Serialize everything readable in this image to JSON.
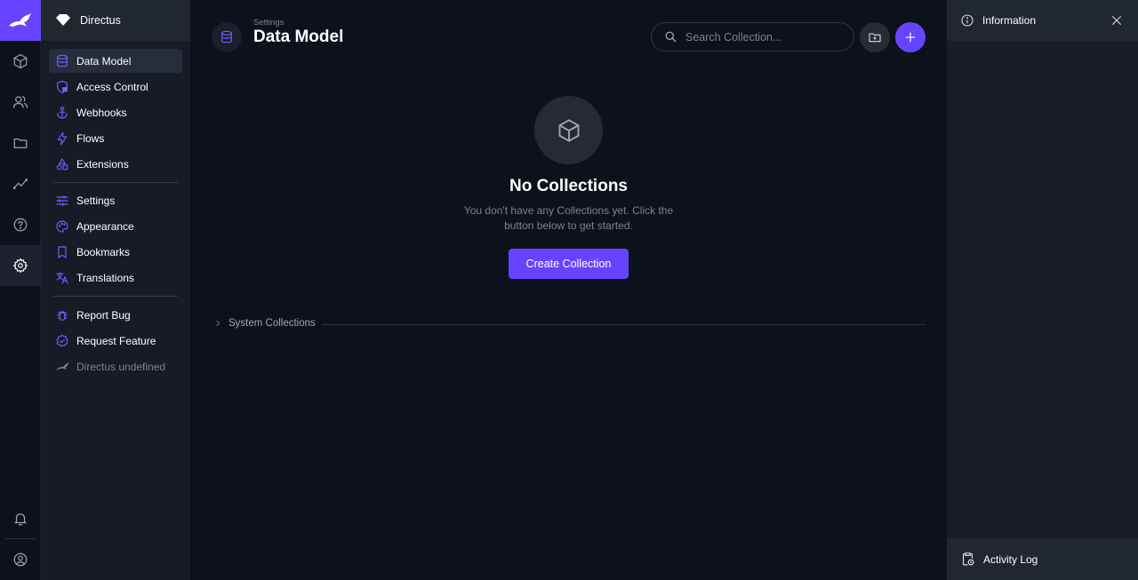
{
  "colors": {
    "accent": "#6644ff",
    "background": "#0c111b",
    "nav": "#161b25"
  },
  "module_bar": {
    "logo": "directus-rabbit-logo",
    "modules": [
      "content-cube-icon",
      "users-icon",
      "files-folder-icon",
      "insights-chart-icon",
      "help-icon",
      "settings-gear-icon"
    ],
    "bottom": [
      "notifications-bell-icon",
      "user-account-icon"
    ]
  },
  "nav": {
    "project_name": "Directus",
    "items": [
      {
        "label": "Data Model",
        "icon": "database-icon"
      },
      {
        "label": "Access Control",
        "icon": "access-control-icon"
      },
      {
        "label": "Webhooks",
        "icon": "anchor-icon"
      },
      {
        "label": "Flows",
        "icon": "bolt-icon"
      },
      {
        "label": "Extensions",
        "icon": "shapes-icon"
      },
      {
        "label": "Settings",
        "icon": "tune-icon"
      },
      {
        "label": "Appearance",
        "icon": "palette-icon"
      },
      {
        "label": "Bookmarks",
        "icon": "bookmark-icon"
      },
      {
        "label": "Translations",
        "icon": "translate-icon"
      },
      {
        "label": "Report Bug",
        "icon": "bug-icon"
      },
      {
        "label": "Request Feature",
        "icon": "verified-icon"
      },
      {
        "label": "Directus undefined",
        "icon": "directus-logo-icon"
      }
    ]
  },
  "header": {
    "breadcrumb": "Settings",
    "title": "Data Model",
    "search_placeholder": "Search Collection..."
  },
  "empty_state": {
    "title": "No Collections",
    "text": "You don't have any Collections yet. Click the button below to get started.",
    "button": "Create Collection"
  },
  "system_collections_label": "System Collections",
  "sidebar": {
    "header": "Information",
    "footer": "Activity Log"
  }
}
